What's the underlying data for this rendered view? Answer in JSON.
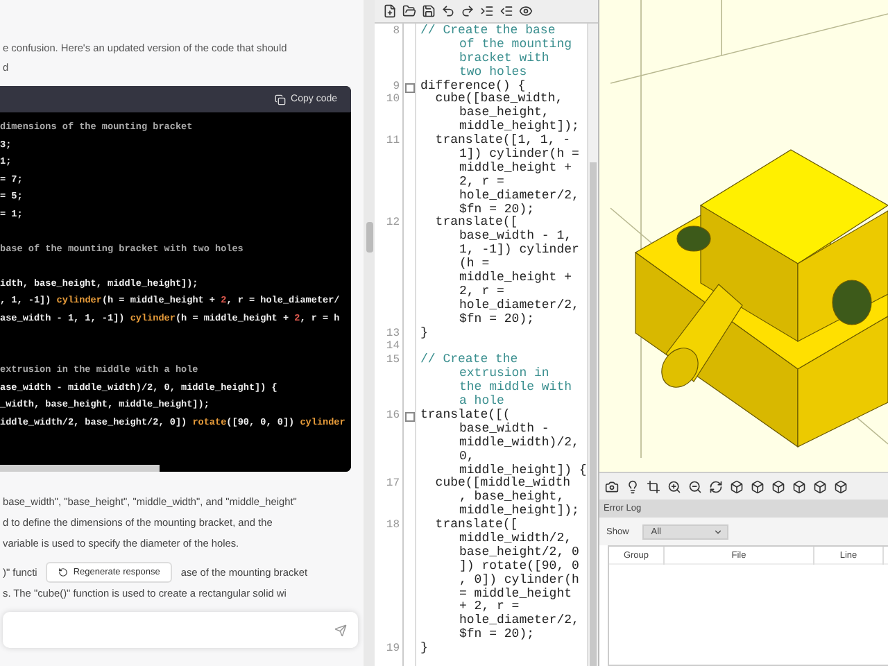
{
  "chat": {
    "intro_lines": [
      "e confusion. Here's an updated version of the code that should",
      "d"
    ],
    "code_block": {
      "copy_label": "Copy code",
      "lines": [
        {
          "segments": [
            {
              "text": "dimensions of the mounting bracket",
              "kind": "comment"
            }
          ]
        },
        {
          "segments": [
            {
              "text": "3;",
              "kind": "plain"
            }
          ]
        },
        {
          "segments": [
            {
              "text": "1;",
              "kind": "plain"
            }
          ]
        },
        {
          "segments": [
            {
              "text": "= 7;",
              "kind": "plain"
            }
          ]
        },
        {
          "segments": [
            {
              "text": "= 5;",
              "kind": "plain"
            }
          ]
        },
        {
          "segments": [
            {
              "text": "= 1;",
              "kind": "plain"
            }
          ]
        },
        {
          "kind": "blank"
        },
        {
          "segments": [
            {
              "text": "base of the mounting bracket with two holes",
              "kind": "comment"
            }
          ]
        },
        {
          "kind": "blank"
        },
        {
          "segments": [
            {
              "text": "idth, base_height, middle_height]);",
              "kind": "plain"
            }
          ]
        },
        {
          "segments": [
            {
              "text": ", 1, -1]) ",
              "kind": "plain"
            },
            {
              "text": "cylinder",
              "kind": "keyword"
            },
            {
              "text": "(h = middle_height + ",
              "kind": "plain"
            },
            {
              "text": "2",
              "kind": "number"
            },
            {
              "text": ", r = hole_diameter/",
              "kind": "plain"
            }
          ]
        },
        {
          "segments": [
            {
              "text": "ase_width - 1, 1, -1]) ",
              "kind": "plain"
            },
            {
              "text": "cylinder",
              "kind": "keyword"
            },
            {
              "text": "(h = middle_height + ",
              "kind": "plain"
            },
            {
              "text": "2",
              "kind": "number"
            },
            {
              "text": ", r = h",
              "kind": "plain"
            }
          ]
        },
        {
          "kind": "blank"
        },
        {
          "kind": "blank"
        },
        {
          "segments": [
            {
              "text": "extrusion in the middle with a hole",
              "kind": "comment"
            }
          ]
        },
        {
          "segments": [
            {
              "text": "ase_width - middle_width)/2, 0, middle_height]) {",
              "kind": "plain"
            }
          ]
        },
        {
          "segments": [
            {
              "text": "_width, base_height, middle_height]);",
              "kind": "plain"
            }
          ]
        },
        {
          "segments": [
            {
              "text": "iddle_width/2, base_height/2, 0]) ",
              "kind": "plain"
            },
            {
              "text": "rotate",
              "kind": "keyword"
            },
            {
              "text": "([90, 0, 0]) ",
              "kind": "plain"
            },
            {
              "text": "cylinder",
              "kind": "keyword"
            }
          ]
        }
      ]
    },
    "paragraph_lines": [
      "base_width\", \"base_height\", \"middle_width\", and \"middle_height\"",
      "d to define the dimensions of the mounting bracket, and the",
      "variable is used to specify the diameter of the holes."
    ],
    "split_line": {
      "before": ")\" functi",
      "after": "ase of the mounting bracket"
    },
    "regenerate_label": "Regenerate response",
    "last_line": "s. The \"cube()\" function is used to create a rectangular solid wi"
  },
  "editor": {
    "lines": [
      {
        "number": "8",
        "kind": "comment",
        "rows": [
          "// Create the base",
          "of the mounting",
          "bracket with",
          "two holes"
        ]
      },
      {
        "number": "9",
        "kind": "code",
        "fold": true,
        "rows": [
          "difference() {"
        ]
      },
      {
        "number": "10",
        "kind": "code",
        "rows": [
          "  cube([base_width,",
          "base_height,",
          "middle_height]);"
        ]
      },
      {
        "number": "11",
        "kind": "code",
        "rows": [
          "  translate([1, 1, -",
          "1]) cylinder(h =",
          "middle_height +",
          "2, r =",
          "hole_diameter/2,",
          "$fn = 20);"
        ]
      },
      {
        "number": "12",
        "kind": "code",
        "rows": [
          "  translate([",
          "base_width - 1,",
          "1, -1]) cylinder",
          "(h =",
          "middle_height +",
          "2, r =",
          "hole_diameter/2,",
          "$fn = 20);"
        ]
      },
      {
        "number": "13",
        "kind": "code",
        "rows": [
          "}"
        ]
      },
      {
        "number": "14",
        "kind": "blank"
      },
      {
        "number": "15",
        "kind": "comment",
        "rows": [
          "// Create the",
          "extrusion in",
          "the middle with",
          "a hole"
        ]
      },
      {
        "number": "16",
        "kind": "code",
        "fold": true,
        "rows": [
          "translate([(",
          "base_width -",
          "middle_width)/2,",
          "0,",
          "middle_height]) {"
        ]
      },
      {
        "number": "17",
        "kind": "code",
        "rows": [
          "  cube([middle_width",
          ", base_height,",
          "middle_height]);"
        ]
      },
      {
        "number": "18",
        "kind": "code",
        "rows": [
          "  translate([",
          "middle_width/2,",
          "base_height/2, 0",
          "]) rotate([90, 0",
          ", 0]) cylinder(h",
          "= middle_height",
          "+ 2, r =",
          "hole_diameter/2,",
          "$fn = 20);"
        ]
      },
      {
        "number": "19",
        "kind": "code",
        "rows": [
          "}"
        ]
      }
    ]
  },
  "error_log": {
    "title": "Error Log",
    "show_label": "Show",
    "show_value": "All",
    "columns": [
      "Group",
      "File",
      "Line"
    ]
  }
}
